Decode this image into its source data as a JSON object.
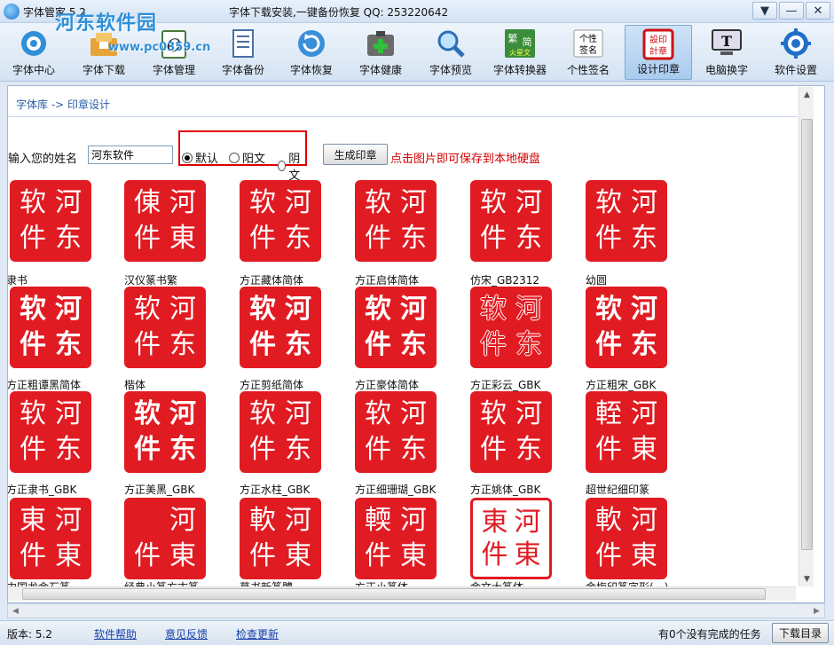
{
  "titlebar": {
    "app_title": "字体管家 5.2",
    "watermark": "河东软件园",
    "watermark_url": "www.pc0359.cn",
    "slogan": "字体下载安装,一键备份恢复 QQ: 253220642",
    "controls": [
      "▼",
      "—",
      "✕"
    ]
  },
  "toolbar": {
    "items": [
      {
        "label": "字体中心",
        "icon": "font-center-icon"
      },
      {
        "label": "字体下载",
        "icon": "font-download-icon"
      },
      {
        "label": "字体管理",
        "icon": "font-manage-icon"
      },
      {
        "label": "字体备份",
        "icon": "font-backup-icon"
      },
      {
        "label": "字体恢复",
        "icon": "font-restore-icon"
      },
      {
        "label": "字体健康",
        "icon": "font-health-icon"
      },
      {
        "label": "字体预览",
        "icon": "font-preview-icon"
      },
      {
        "label": "字体转换器",
        "icon": "font-converter-icon",
        "badge_top": "繁",
        "badge_mid": "简",
        "badge_bot": "火星文"
      },
      {
        "label": "个性签名",
        "icon": "signature-icon",
        "badge_top": "个性",
        "badge_bot": "签名"
      },
      {
        "label": "设计印章",
        "icon": "seal-design-icon",
        "badge_top": "设印",
        "badge_bot": "計章"
      },
      {
        "label": "电脑换字",
        "icon": "computer-font-icon",
        "badge_top": "T"
      },
      {
        "label": "软件设置",
        "icon": "settings-gear-icon"
      }
    ],
    "active_index": 9
  },
  "breadcrumb": "字体库 -> 印章设计",
  "form": {
    "name_label": "输入您的姓名",
    "name_value": "河东软件",
    "radios": [
      "默认",
      "阳文",
      "阴文"
    ],
    "selected_radio": 0,
    "generate_button": "生成印章",
    "hint": "点击图片即可保存到本地硬盘"
  },
  "stamp_chars": [
    "软",
    "河",
    "件",
    "东"
  ],
  "stamps": [
    {
      "name": "隶书",
      "style": "solid"
    },
    {
      "name": "汉仪篆书繁",
      "style": "seal",
      "chars": [
        "倲",
        "河",
        "件",
        "東"
      ]
    },
    {
      "name": "方正藏体简体",
      "style": "solid"
    },
    {
      "name": "方正启体简体",
      "style": "solid"
    },
    {
      "name": "仿宋_GB2312",
      "style": "solid"
    },
    {
      "name": "幼圆",
      "style": "solid"
    },
    {
      "name": "方正粗谭黑简体",
      "style": "yin-bold"
    },
    {
      "name": "楷体",
      "style": "solid"
    },
    {
      "name": "方正剪纸简体",
      "style": "yin-bold"
    },
    {
      "name": "方正豪体简体",
      "style": "bold"
    },
    {
      "name": "方正彩云_GBK",
      "style": "outline"
    },
    {
      "name": "方正粗宋_GBK",
      "style": "bold"
    },
    {
      "name": "方正隶书_GBK",
      "style": "solid"
    },
    {
      "name": "方正美黑_GBK",
      "style": "bold"
    },
    {
      "name": "方正水柱_GBK",
      "style": "solid"
    },
    {
      "name": "方正细珊瑚_GBK",
      "style": "solid"
    },
    {
      "name": "方正姚体_GBK",
      "style": "solid"
    },
    {
      "name": "超世纪细印篆",
      "style": "seal",
      "chars": [
        "輊",
        "河",
        "件",
        "東"
      ]
    },
    {
      "name": "中国龙金石篆",
      "style": "seal",
      "chars": [
        "東",
        "河",
        "件",
        "東"
      ]
    },
    {
      "name": "经典小篆方古篆",
      "style": "solid-seal",
      "chars": [
        "",
        "河",
        "件",
        "東"
      ]
    },
    {
      "name": "草书新篆體",
      "style": "seal",
      "chars": [
        "軟",
        "河",
        "件",
        "東"
      ]
    },
    {
      "name": "方正小篆体",
      "style": "seal",
      "chars": [
        "輭",
        "河",
        "件",
        "東"
      ]
    },
    {
      "name": "金文大篆体",
      "style": "yin-seal",
      "chars": [
        "東",
        "河",
        "件",
        "東"
      ]
    },
    {
      "name": "金梅印篆字形(一)",
      "style": "seal",
      "chars": [
        "軟",
        "河",
        "件",
        "東"
      ]
    }
  ],
  "statusbar": {
    "version": "版本: 5.2",
    "links": [
      "软件帮助",
      "意见反馈",
      "检查更新"
    ],
    "task_text": "有0个没有完成的任务",
    "download_button": "下载目录"
  },
  "colors": {
    "seal_red": "#e11b22",
    "highlight_box": "#e00000",
    "hint_red": "#d40000",
    "link_blue": "#1a3fa8"
  }
}
